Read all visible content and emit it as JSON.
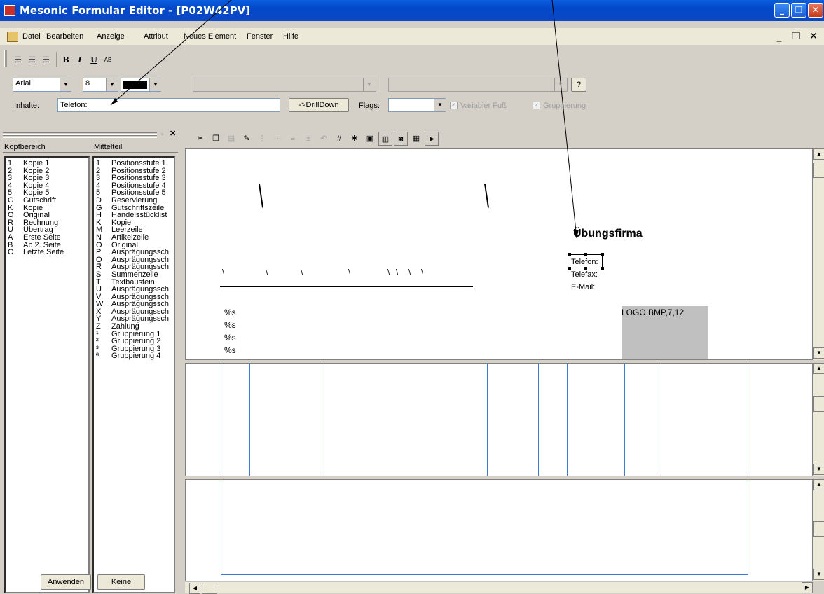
{
  "window": {
    "title": "Mesonic Formular Editor - [P02W42PV]"
  },
  "menu": {
    "items": [
      "Datei",
      "Bearbeiten",
      "Anzeige",
      "Attribut",
      "Neues Element",
      "Fenster",
      "Hilfe"
    ]
  },
  "format_toolbar": {
    "bold": "B",
    "italic": "I",
    "underline": "U",
    "strike": "AB"
  },
  "font_bar": {
    "font_name": "Arial",
    "font_size": "8",
    "help_label": "?",
    "inhalte_label": "Inhalte:",
    "inhalte_value": "Telefon:",
    "drilldown_label": "->DrillDown",
    "flags_label": "Flags:",
    "variabler_fuss_label": "Variabler Fuß",
    "gruppierung_label": "Gruppierung"
  },
  "left_panel": {
    "kopf_header": "Kopfbereich",
    "mittel_header": "Mittelteil",
    "kopf_items": [
      {
        "k": "1",
        "v": "Kopie 1"
      },
      {
        "k": "2",
        "v": "Kopie 2"
      },
      {
        "k": "3",
        "v": "Kopie 3"
      },
      {
        "k": "4",
        "v": "Kopie 4"
      },
      {
        "k": "5",
        "v": "Kopie 5"
      },
      {
        "k": "G",
        "v": "Gutschrift"
      },
      {
        "k": "K",
        "v": "Kopie"
      },
      {
        "k": "O",
        "v": "Original"
      },
      {
        "k": "R",
        "v": "Rechnung"
      },
      {
        "k": "U",
        "v": "Übertrag"
      },
      {
        "k": "A",
        "v": "Erste Seite"
      },
      {
        "k": "B",
        "v": "Ab 2. Seite"
      },
      {
        "k": "C",
        "v": "Letzte Seite"
      }
    ],
    "mittel_items": [
      {
        "k": "1",
        "v": "Positionsstufe 1"
      },
      {
        "k": "2",
        "v": "Positionsstufe 2"
      },
      {
        "k": "3",
        "v": "Positionsstufe 3"
      },
      {
        "k": "4",
        "v": "Positionsstufe 4"
      },
      {
        "k": "5",
        "v": "Positionsstufe 5"
      },
      {
        "k": "D",
        "v": "Reservierung"
      },
      {
        "k": "G",
        "v": "Gutschriftszeile"
      },
      {
        "k": "H",
        "v": "Handelsstücklist"
      },
      {
        "k": "K",
        "v": "Kopie"
      },
      {
        "k": "M",
        "v": "Leerzeile"
      },
      {
        "k": "N",
        "v": "Artikelzeile"
      },
      {
        "k": "O",
        "v": "Original"
      },
      {
        "k": "P",
        "v": "Ausprägungssch"
      },
      {
        "k": "Q",
        "v": "Ausprägungssch"
      },
      {
        "k": "R",
        "v": "Ausprägungssch"
      },
      {
        "k": "S",
        "v": "Summenzeile"
      },
      {
        "k": "T",
        "v": "Textbaustein"
      },
      {
        "k": "U",
        "v": "Ausprägungssch"
      },
      {
        "k": "V",
        "v": "Ausprägungssch"
      },
      {
        "k": "W",
        "v": "Ausprägungssch"
      },
      {
        "k": "X",
        "v": "Ausprägungssch"
      },
      {
        "k": "Y",
        "v": "Ausprägungssch"
      },
      {
        "k": "Z",
        "v": "Zahlung"
      },
      {
        "k": "¹",
        "v": "Gruppierung 1"
      },
      {
        "k": "²",
        "v": "Gruppierung 2"
      },
      {
        "k": "³",
        "v": "Gruppierung 3"
      },
      {
        "k": "ª",
        "v": "Gruppierung 4"
      }
    ],
    "apply_label": "Anwenden",
    "none_label": "Keine"
  },
  "canvas": {
    "company": "Übungsfirma",
    "telefon": "Telefon:",
    "telefax": "Telefax:",
    "email": "E-Mail:",
    "logo": "LOGO.BMP,7,12",
    "placeholders": [
      "%s",
      "%s",
      "%s",
      "%s"
    ],
    "backslash": "\\"
  },
  "colors": {
    "accent": "#3a7bd5",
    "titlebar": "#0347c9"
  }
}
